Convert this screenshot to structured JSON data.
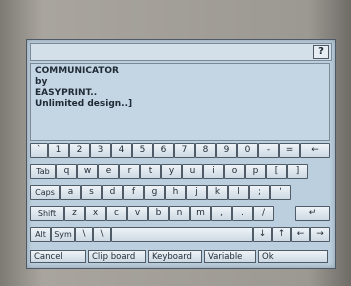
{
  "dialog": {
    "help_label": "?"
  },
  "text_area": {
    "content": "COMMUNICATOR\nby\nEASYPRINT..\nUnlimited design..]"
  },
  "keyboard": {
    "row1": [
      "`",
      "1",
      "2",
      "3",
      "4",
      "5",
      "6",
      "7",
      "8",
      "9",
      "0",
      "-",
      "=",
      "←"
    ],
    "row2": [
      "Tab",
      "q",
      "w",
      "e",
      "r",
      "t",
      "y",
      "u",
      "i",
      "o",
      "p",
      "[",
      "]"
    ],
    "row3": [
      "Caps",
      "a",
      "s",
      "d",
      "f",
      "g",
      "h",
      "j",
      "k",
      "l",
      ";",
      "'"
    ],
    "row4": [
      "Shift",
      "z",
      "x",
      "c",
      "v",
      "b",
      "n",
      "m",
      ",",
      ".",
      "/",
      "↵"
    ],
    "row5": [
      "Alt",
      "Sym",
      "\\",
      "\\",
      "",
      "↓",
      "↑",
      "←",
      "→"
    ]
  },
  "bottom_bar": {
    "cancel": "Cancel",
    "clipboard": "Clip board",
    "keyboard": "Keyboard",
    "variable": "Variable",
    "ok": "Ok"
  }
}
